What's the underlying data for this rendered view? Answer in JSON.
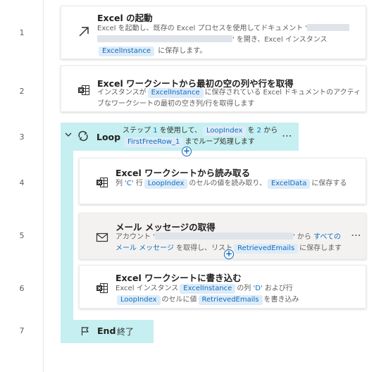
{
  "line_numbers": [
    "1",
    "2",
    "3",
    "4",
    "5",
    "6",
    "7"
  ],
  "actions": [
    {
      "title": "Excel の起動",
      "icon": "arrow-launch-icon",
      "desc": {
        "a": "Excel を起動し、既存の Excel プロセスを使用してドキュメント '",
        "b": "' を開き、Excel インスタンス",
        "var": "ExcelInstance",
        "c": " に保存します。"
      }
    },
    {
      "title": "Excel ワークシートから最初の空の列や行を取得",
      "icon": "excel-icon",
      "desc": {
        "a": "インスタンスが",
        "var": "ExcelInstance",
        "b": "に保存されている Excel ドキュメントのアクティブなワークシートの最初の空き列/行を取得します"
      }
    },
    {
      "title": "Loop",
      "icon": "loop-icon",
      "desc": {
        "a": "ステップ",
        "step": "1",
        "b": "を使用して、",
        "var1": "LoopIndex",
        "c": "を",
        "start": "2",
        "d": "から",
        "var2": "FirstFreeRow_1",
        "e": "までループ処理します"
      }
    },
    {
      "title": "Excel ワークシートから読み取る",
      "icon": "excel-icon",
      "desc": {
        "a": "列",
        "col": "'C'",
        "b": "行",
        "var1": "LoopIndex",
        "c": "のセルの値を読み取り、",
        "var2": "ExcelData",
        "d": "に保存する"
      }
    },
    {
      "title": "メール メッセージの取得",
      "icon": "mail-icon",
      "desc": {
        "a": "アカウント '",
        "b": "' から",
        "link1": "すべての",
        "link2": "メール メッセージ",
        "c": "を取得し、リスト",
        "var": "RetrievedEmails",
        "d": "に保存します"
      }
    },
    {
      "title": "Excel ワークシートに書き込む",
      "icon": "excel-icon",
      "desc": {
        "a": "Excel インスタンス",
        "var1": "ExcelInstance",
        "b": "の列",
        "col": "'D'",
        "c": "および行",
        "var2": "LoopIndex",
        "d": "のセルに値",
        "var3": "RetrievedEmails",
        "e": "を書き込み"
      }
    },
    {
      "title": "End",
      "icon": "flag-icon",
      "label": "終了"
    }
  ],
  "colors": {
    "loop_highlight": "#c5eff0",
    "variable_tag_bg": "#deecf9",
    "variable_tag_text": "#0f6cbd",
    "selected_card_bg": "#f3f2f1"
  }
}
